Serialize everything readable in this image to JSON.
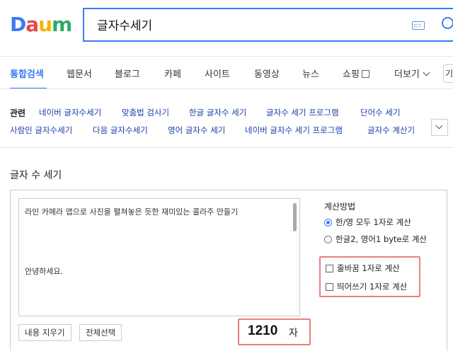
{
  "header": {
    "logo_letters": [
      "D",
      "a",
      "u",
      "m"
    ],
    "logo_colors": [
      "#3b7cf3",
      "#e04a4a",
      "#f4b400",
      "#2eaa6b"
    ],
    "search_value": "글자수세기"
  },
  "tabs": [
    {
      "label": "통합검색",
      "active": true
    },
    {
      "label": "웹문서"
    },
    {
      "label": "블로그"
    },
    {
      "label": "카페"
    },
    {
      "label": "사이트"
    },
    {
      "label": "동영상"
    },
    {
      "label": "뉴스"
    },
    {
      "label": "쇼핑"
    },
    {
      "label": "더보기"
    }
  ],
  "tab_edge_text": "기",
  "related": {
    "label": "관련",
    "items": [
      "네이버 글자수세기",
      "맞춤법 검사기",
      "한글 글자수 세기",
      "글자수 세기 프로그램",
      "단어수 세기",
      "사람인 글자수세기",
      "다음 글자수세기",
      "영어 글자수 세기",
      "네이버 글자수 세기 프로그램",
      "글자수 계산기"
    ]
  },
  "tool": {
    "title": "글자 수 세기",
    "text_lines": [
      "라인 카메라 앱으로 사진을 펼쳐놓은 듯한 재미있는 콜라주 만들기",
      "",
      "",
      "안녕하세요."
    ],
    "method_title": "계산방법",
    "radio_options": [
      {
        "label": "한/영 모두 1자로 계산",
        "selected": true
      },
      {
        "label": "한글2, 영어1 byte로 계산",
        "selected": false
      }
    ],
    "checkboxes": [
      {
        "label": "줄바꿈 1자로 계산",
        "checked": false
      },
      {
        "label": "띄어쓰기 1자로 계산",
        "checked": false
      }
    ],
    "clear_button": "내용 지우기",
    "select_all_button": "전체선택",
    "count": "1210",
    "count_unit": "자",
    "highlight_color": "#e8807f"
  }
}
